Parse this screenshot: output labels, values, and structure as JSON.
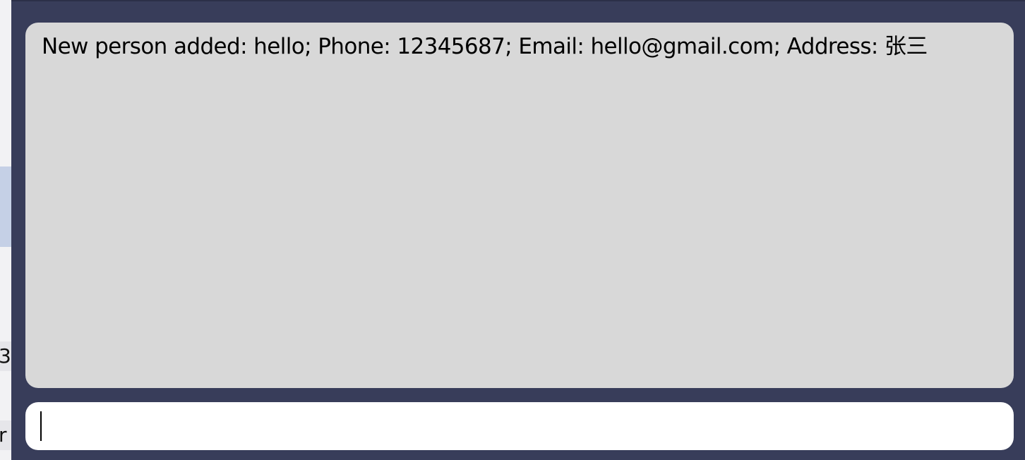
{
  "background_window": {
    "fragments": [
      "3",
      "r"
    ]
  },
  "result_display": {
    "text": "New person added: hello; Phone: 12345687; Email: hello@gmail.com; Address: 张三"
  },
  "command_box": {
    "value": "",
    "placeholder": ""
  },
  "colors": {
    "window_background": "#383d5a",
    "result_background": "#d8d8d8",
    "input_background": "#ffffff"
  }
}
